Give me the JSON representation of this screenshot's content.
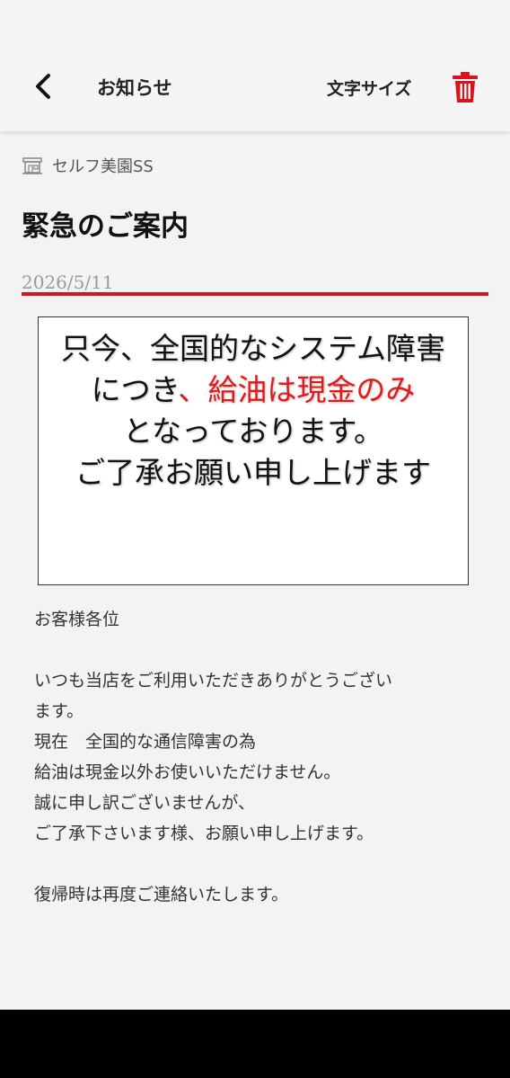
{
  "header": {
    "title": "お知らせ",
    "font_size_label": "文字サイズ",
    "back_icon": "chevron-left-icon",
    "delete_icon": "trash-icon",
    "accent_color": "#d7141b"
  },
  "store": {
    "name": "セルフ美園SS",
    "icon": "store-icon"
  },
  "article": {
    "title": "緊急のご案内",
    "date": "2026/5/11"
  },
  "notice": {
    "line1": "只今、全国的なシステム障害",
    "line2_prefix": "につき",
    "line2_highlight": "、給油は現金のみ",
    "line3": "となっております。",
    "line4": "ご了承お願い申し上げます",
    "highlight_color": "#e21a1a"
  },
  "body": {
    "greeting": "お客様各位",
    "line1": "いつも当店をご利用いただきありがとうござい",
    "line2": "ます。",
    "line3": "現在　全国的な通信障害の為",
    "line4": "給油は現金以外お使いいただけません。",
    "line5": "誠に申し訳ございませんが、",
    "line6": "ご了承下さいます様、お願い申し上げます。",
    "line7": "復帰時は再度ご連絡いたします。"
  }
}
